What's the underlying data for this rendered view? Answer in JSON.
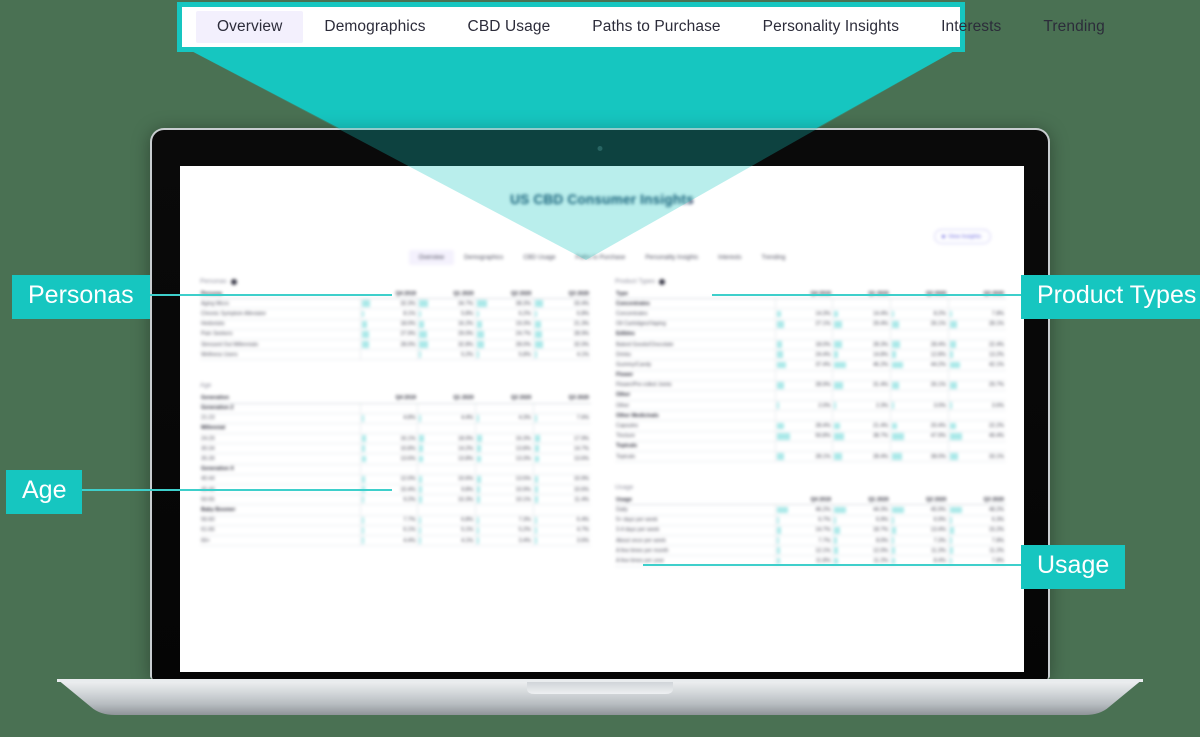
{
  "background_color": "#4a7153",
  "accent_color": "#16c6c0",
  "magnified_tabs": {
    "items": [
      {
        "label": "Overview",
        "active": true
      },
      {
        "label": "Demographics",
        "active": false
      },
      {
        "label": "CBD Usage",
        "active": false
      },
      {
        "label": "Paths to Purchase",
        "active": false
      },
      {
        "label": "Personality Insights",
        "active": false
      },
      {
        "label": "Interests",
        "active": false
      },
      {
        "label": "Trending",
        "active": false
      }
    ]
  },
  "callouts": {
    "personas": "Personas",
    "age": "Age",
    "product_types": "Product Types",
    "usage": "Usage"
  },
  "dashboard": {
    "title": "US CBD Consumer Insights",
    "action_button": "View Insights",
    "tabs": [
      {
        "label": "Overview",
        "active": true
      },
      {
        "label": "Demographics",
        "active": false
      },
      {
        "label": "CBD Usage",
        "active": false
      },
      {
        "label": "Paths to Purchase",
        "active": false
      },
      {
        "label": "Personality Insights",
        "active": false
      },
      {
        "label": "Interests",
        "active": false
      },
      {
        "label": "Trending",
        "active": false
      }
    ],
    "quarters": [
      "Q4 2019",
      "Q1 2020",
      "Q2 2020",
      "Q3 2020"
    ],
    "sections": [
      {
        "id": "personas",
        "title": "Personas",
        "has_icon": true,
        "first_col_header": "Persona",
        "rows": [
          {
            "label": "Aging Micro",
            "type": "item",
            "values": [
              "32.3%",
              "34.7%",
              "38.3%",
              "33.4%"
            ],
            "bars": [
              0.62,
              0.66,
              0.72,
              0.64
            ]
          },
          {
            "label": "Chronic Symptom Alleviator",
            "type": "item",
            "values": [
              "8.1%",
              "5.8%",
              "6.2%",
              "6.8%"
            ],
            "bars": [
              0.18,
              0.13,
              0.14,
              0.15
            ]
          },
          {
            "label": "Hedonists",
            "type": "item",
            "values": [
              "18.0%",
              "16.2%",
              "19.3%",
              "21.3%"
            ],
            "bars": [
              0.38,
              0.34,
              0.4,
              0.44
            ]
          },
          {
            "label": "Pain Seekers",
            "type": "item",
            "values": [
              "27.9%",
              "29.0%",
              "24.7%",
              "28.9%"
            ],
            "bars": [
              0.55,
              0.57,
              0.5,
              0.57
            ]
          },
          {
            "label": "Stressed Out Millennials",
            "type": "item",
            "values": [
              "28.0%",
              "32.8%",
              "28.0%",
              "32.0%"
            ],
            "bars": [
              0.56,
              0.64,
              0.56,
              0.62
            ]
          },
          {
            "label": "Wellness Users",
            "type": "item",
            "values": [
              "",
              "5.2%",
              "5.8%",
              "4.1%"
            ],
            "bars": [
              0,
              0.05,
              0.06,
              0.04
            ]
          }
        ]
      },
      {
        "id": "age",
        "title": "Age",
        "has_icon": false,
        "first_col_header": "Generation",
        "rows": [
          {
            "label": "Generation Z",
            "type": "group",
            "values": [
              "",
              "",
              "",
              ""
            ],
            "bars": [
              0,
              0,
              0,
              0
            ]
          },
          {
            "label": "21-23",
            "type": "item",
            "values": [
              "4.8%",
              "4.4%",
              "4.3%",
              "7.6%"
            ],
            "bars": [
              0.1,
              0.09,
              0.09,
              0.15
            ]
          },
          {
            "label": "Millennial",
            "type": "group",
            "values": [
              "",
              "",
              "",
              ""
            ],
            "bars": [
              0,
              0,
              0,
              0
            ]
          },
          {
            "label": "24-29",
            "type": "item",
            "values": [
              "16.1%",
              "18.0%",
              "16.3%",
              "17.9%"
            ],
            "bars": [
              0.34,
              0.38,
              0.34,
              0.38
            ]
          },
          {
            "label": "30-34",
            "type": "item",
            "values": [
              "10.8%",
              "14.2%",
              "13.8%",
              "14.7%"
            ],
            "bars": [
              0.23,
              0.3,
              0.29,
              0.31
            ]
          },
          {
            "label": "35-39",
            "type": "item",
            "values": [
              "13.6%",
              "13.8%",
              "13.3%",
              "13.6%"
            ],
            "bars": [
              0.29,
              0.29,
              0.28,
              0.29
            ]
          },
          {
            "label": "Generation X",
            "type": "group",
            "values": [
              "",
              "",
              "",
              ""
            ],
            "bars": [
              0,
              0,
              0,
              0
            ]
          },
          {
            "label": "40-44",
            "type": "item",
            "values": [
              "12.0%",
              "10.6%",
              "13.5%",
              "10.9%"
            ],
            "bars": [
              0.26,
              0.23,
              0.29,
              0.23
            ]
          },
          {
            "label": "45-49",
            "type": "item",
            "values": [
              "10.4%",
              "9.8%",
              "10.9%",
              "10.6%"
            ],
            "bars": [
              0.22,
              0.21,
              0.23,
              0.22
            ]
          },
          {
            "label": "50-55",
            "type": "item",
            "values": [
              "9.2%",
              "10.3%",
              "10.1%",
              "11.4%"
            ],
            "bars": [
              0.2,
              0.22,
              0.21,
              0.24
            ]
          },
          {
            "label": "Baby Boomer",
            "type": "group",
            "values": [
              "",
              "",
              "",
              ""
            ],
            "bars": [
              0,
              0,
              0,
              0
            ]
          },
          {
            "label": "56-60",
            "type": "item",
            "values": [
              "7.7%",
              "6.8%",
              "7.3%",
              "6.4%"
            ],
            "bars": [
              0.17,
              0.15,
              0.16,
              0.14
            ]
          },
          {
            "label": "61-66",
            "type": "item",
            "values": [
              "6.1%",
              "5.1%",
              "5.2%",
              "4.7%"
            ],
            "bars": [
              0.13,
              0.11,
              0.11,
              0.1
            ]
          },
          {
            "label": "66+",
            "type": "item",
            "values": [
              "4.4%",
              "4.1%",
              "3.4%",
              "3.6%"
            ],
            "bars": [
              0.1,
              0.09,
              0.08,
              0.08
            ]
          }
        ]
      },
      {
        "id": "product_types",
        "title": "Product Types",
        "has_icon": true,
        "first_col_header": "Type",
        "rows": [
          {
            "label": "Concentrates",
            "type": "group",
            "values": [
              "",
              "",
              "",
              ""
            ],
            "bars": [
              0,
              0,
              0,
              0
            ]
          },
          {
            "label": "Concentrates",
            "type": "item",
            "values": [
              "14.3%",
              "14.4%",
              "8.2%",
              "7.8%"
            ],
            "bars": [
              0.3,
              0.3,
              0.18,
              0.17
            ]
          },
          {
            "label": "Oil Cartridges/Vaping",
            "type": "item",
            "values": [
              "27.1%",
              "29.4%",
              "26.1%",
              "28.1%"
            ],
            "bars": [
              0.54,
              0.58,
              0.52,
              0.56
            ]
          },
          {
            "label": "Edibles",
            "type": "group",
            "values": [
              "",
              "",
              "",
              ""
            ],
            "bars": [
              0,
              0,
              0,
              0
            ]
          },
          {
            "label": "Baked Goods/Chocolate",
            "type": "item",
            "values": [
              "18.0%",
              "28.3%",
              "28.4%",
              "22.4%"
            ],
            "bars": [
              0.38,
              0.57,
              0.57,
              0.46
            ]
          },
          {
            "label": "Drinks",
            "type": "item",
            "values": [
              "24.4%",
              "14.8%",
              "12.8%",
              "13.2%"
            ],
            "bars": [
              0.49,
              0.31,
              0.28,
              0.28
            ]
          },
          {
            "label": "Gummy/Candy",
            "type": "item",
            "values": [
              "37.4%",
              "46.2%",
              "44.2%",
              "42.1%"
            ],
            "bars": [
              0.73,
              0.9,
              0.86,
              0.82
            ]
          },
          {
            "label": "Flower",
            "type": "group",
            "values": [
              "",
              "",
              "",
              ""
            ],
            "bars": [
              0,
              0,
              0,
              0
            ]
          },
          {
            "label": "Flower/Pre-rolled Joints",
            "type": "item",
            "values": [
              "28.9%",
              "31.4%",
              "26.1%",
              "29.7%"
            ],
            "bars": [
              0.58,
              0.62,
              0.52,
              0.59
            ]
          },
          {
            "label": "Other",
            "type": "group",
            "values": [
              "",
              "",
              "",
              ""
            ],
            "bars": [
              0,
              0,
              0,
              0
            ]
          },
          {
            "label": "Other",
            "type": "item",
            "values": [
              "2.0%",
              "2.3%",
              "3.0%",
              "3.6%"
            ],
            "bars": [
              0.04,
              0.05,
              0.06,
              0.08
            ]
          },
          {
            "label": "Other Medicinals",
            "type": "group",
            "values": [
              "",
              "",
              "",
              ""
            ],
            "bars": [
              0,
              0,
              0,
              0
            ]
          },
          {
            "label": "Capsules",
            "type": "item",
            "values": [
              "28.4%",
              "21.4%",
              "20.4%",
              "22.2%"
            ],
            "bars": [
              0.57,
              0.43,
              0.41,
              0.45
            ]
          },
          {
            "label": "Tincture",
            "type": "item",
            "values": [
              "50.8%",
              "38.7%",
              "47.9%",
              "49.4%"
            ],
            "bars": [
              0.98,
              0.76,
              0.94,
              0.97
            ]
          },
          {
            "label": "Topicals",
            "type": "group",
            "values": [
              "",
              "",
              "",
              ""
            ],
            "bars": [
              0,
              0,
              0,
              0
            ]
          },
          {
            "label": "Topicals",
            "type": "item",
            "values": [
              "28.1%",
              "28.4%",
              "38.0%",
              "33.1%"
            ],
            "bars": [
              0.56,
              0.57,
              0.75,
              0.66
            ]
          }
        ]
      },
      {
        "id": "usage",
        "title": "Usage",
        "has_icon": false,
        "first_col_header": "Usage",
        "rows": [
          {
            "label": "Daily",
            "type": "item",
            "values": [
              "46.2%",
              "44.3%",
              "45.9%",
              "48.2%"
            ],
            "bars": [
              0.9,
              0.87,
              0.89,
              0.94
            ]
          },
          {
            "label": "5+ days per week",
            "type": "item",
            "values": [
              "6.7%",
              "6.9%",
              "6.9%",
              "6.3%"
            ],
            "bars": [
              0.15,
              0.15,
              0.15,
              0.14
            ]
          },
          {
            "label": "3-4 days per week",
            "type": "item",
            "values": [
              "14.7%",
              "18.7%",
              "13.4%",
              "15.2%"
            ],
            "bars": [
              0.31,
              0.39,
              0.29,
              0.32
            ]
          },
          {
            "label": "About once per week",
            "type": "item",
            "values": [
              "7.7%",
              "8.0%",
              "7.3%",
              "7.8%"
            ],
            "bars": [
              0.17,
              0.18,
              0.16,
              0.17
            ]
          },
          {
            "label": "A few times per month",
            "type": "item",
            "values": [
              "12.1%",
              "12.0%",
              "11.3%",
              "11.2%"
            ],
            "bars": [
              0.26,
              0.26,
              0.25,
              0.25
            ]
          },
          {
            "label": "A few times per year",
            "type": "item",
            "values": [
              "11.8%",
              "11.2%",
              "8.4%",
              "7.8%"
            ],
            "bars": [
              0.25,
              0.24,
              0.19,
              0.17
            ]
          }
        ]
      }
    ]
  }
}
